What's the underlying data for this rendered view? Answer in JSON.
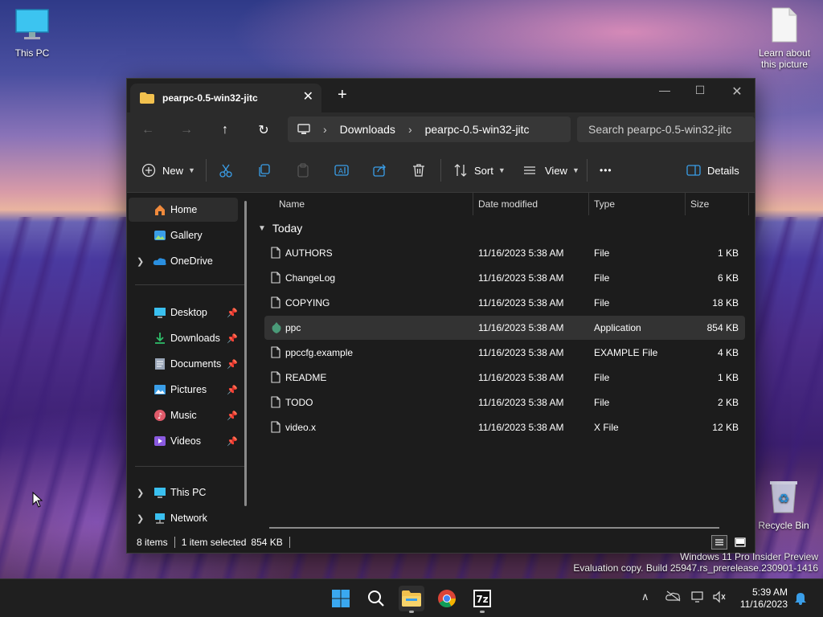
{
  "desktop": {
    "icons": [
      {
        "label": "This PC"
      },
      {
        "label_line1": "Learn about",
        "label_line2": "this picture"
      },
      {
        "label": "Recycle Bin"
      }
    ]
  },
  "window": {
    "tab_title": "pearpc-0.5-win32-jitc",
    "address": {
      "segments": [
        "Downloads",
        "pearpc-0.5-win32-jitc"
      ]
    },
    "search_placeholder": "Search pearpc-0.5-win32-jitc",
    "toolbar": {
      "new_label": "New",
      "sort_label": "Sort",
      "view_label": "View",
      "more_label": "•••",
      "details_label": "Details"
    },
    "sidebar": {
      "items": [
        {
          "label": "Home"
        },
        {
          "label": "Gallery"
        },
        {
          "label": "OneDrive"
        },
        {
          "label": "Desktop"
        },
        {
          "label": "Downloads"
        },
        {
          "label": "Documents"
        },
        {
          "label": "Pictures"
        },
        {
          "label": "Music"
        },
        {
          "label": "Videos"
        },
        {
          "label": "This PC"
        },
        {
          "label": "Network"
        }
      ]
    },
    "columns": {
      "name": "Name",
      "date": "Date modified",
      "type": "Type",
      "size": "Size"
    },
    "group_label": "Today",
    "files": [
      {
        "name": "AUTHORS",
        "date": "11/16/2023 5:38 AM",
        "type": "File",
        "size": "1 KB"
      },
      {
        "name": "ChangeLog",
        "date": "11/16/2023 5:38 AM",
        "type": "File",
        "size": "6 KB"
      },
      {
        "name": "COPYING",
        "date": "11/16/2023 5:38 AM",
        "type": "File",
        "size": "18 KB"
      },
      {
        "name": "ppc",
        "date": "11/16/2023 5:38 AM",
        "type": "Application",
        "size": "854 KB"
      },
      {
        "name": "ppccfg.example",
        "date": "11/16/2023 5:38 AM",
        "type": "EXAMPLE File",
        "size": "4 KB"
      },
      {
        "name": "README",
        "date": "11/16/2023 5:38 AM",
        "type": "File",
        "size": "1 KB"
      },
      {
        "name": "TODO",
        "date": "11/16/2023 5:38 AM",
        "type": "File",
        "size": "2 KB"
      },
      {
        "name": "video.x",
        "date": "11/16/2023 5:38 AM",
        "type": "X File",
        "size": "12 KB"
      }
    ],
    "status": {
      "items_count": "8 items",
      "selected": "1 item selected",
      "selected_size": "854 KB"
    }
  },
  "watermark": {
    "line1": "Windows 11 Pro Insider Preview",
    "line2": "Evaluation copy. Build 25947.rs_prerelease.230901-1416"
  },
  "taskbar": {
    "time": "5:39 AM",
    "date": "11/16/2023"
  },
  "colors": {
    "accent": "#3a9ee8",
    "folder": "#f2c14e",
    "window_bg": "#1c1c1c"
  }
}
